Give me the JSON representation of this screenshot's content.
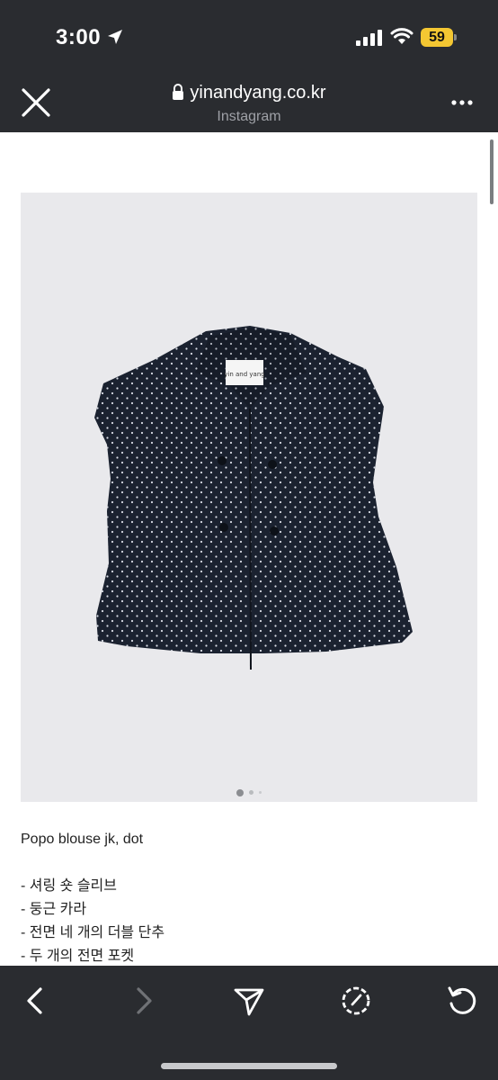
{
  "status_bar": {
    "time": "3:00",
    "battery_percent": "59",
    "battery_color": "#f4c732"
  },
  "browser_header": {
    "url": "yinandyang.co.kr",
    "subtitle": "Instagram",
    "close_icon": "close-icon",
    "more_icon": "more-icon"
  },
  "carousel": {
    "total_images": 3,
    "active_index": 0
  },
  "product": {
    "title": "Popo blouse jk, dot",
    "features": [
      "- 셔링 숏 슬리브",
      "- 둥근 카라",
      "- 전면 네 개의 더블 단추",
      "- 두 개의 전면 포켓"
    ],
    "label_text": "yin and yang"
  },
  "bottom_toolbar": {
    "buttons": [
      "back-icon",
      "forward-icon",
      "share-icon",
      "browser-icon",
      "reload-icon"
    ],
    "forward_disabled": true
  },
  "colors": {
    "chrome_bg": "#2a2c30",
    "image_bg": "#e9e9ec",
    "garment": "#1b2230"
  }
}
